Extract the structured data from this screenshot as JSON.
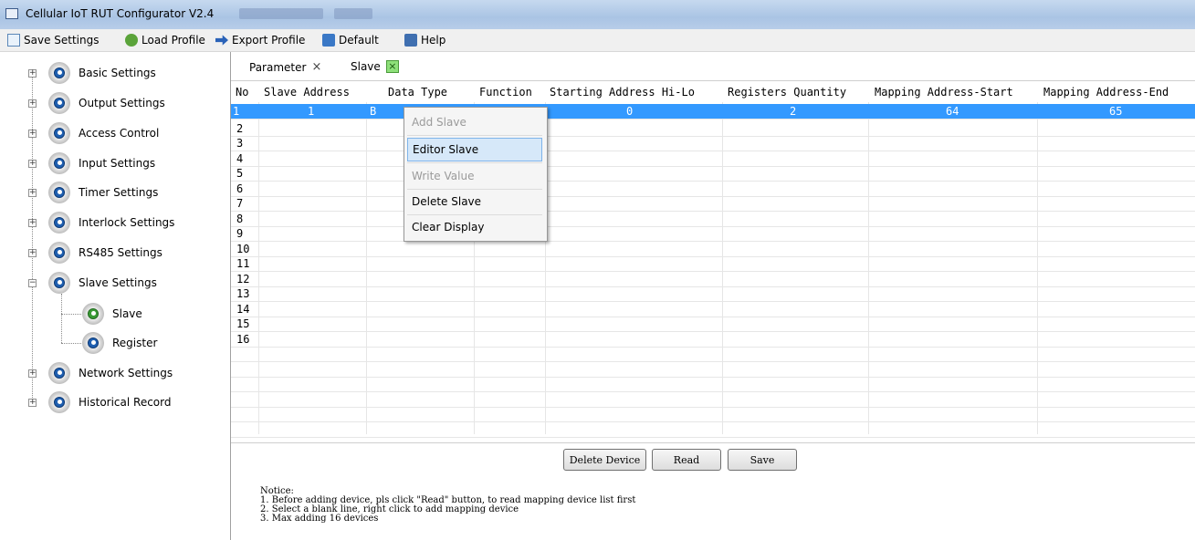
{
  "window": {
    "title": "Cellular IoT RUT Configurator V2.4"
  },
  "toolbar": {
    "save": "Save Settings",
    "load": "Load Profile",
    "export": "Export Profile",
    "default": "Default",
    "help": "Help"
  },
  "sidebar": {
    "items": [
      {
        "label": "Basic Settings"
      },
      {
        "label": "Output Settings"
      },
      {
        "label": "Access Control"
      },
      {
        "label": "Input Settings"
      },
      {
        "label": "Timer Settings"
      },
      {
        "label": "Interlock Settings"
      },
      {
        "label": "RS485 Settings"
      },
      {
        "label": "Slave Settings"
      },
      {
        "label": "Slave"
      },
      {
        "label": "Register"
      },
      {
        "label": "Network Settings"
      },
      {
        "label": "Historical Record"
      }
    ]
  },
  "tabs": [
    {
      "label": "Parameter",
      "close": "×"
    },
    {
      "label": "Slave",
      "close": "×"
    }
  ],
  "table": {
    "headers": [
      "No",
      "Slave Address",
      "Data Type",
      "Function",
      "Starting Address Hi-Lo",
      "Registers Quantity",
      "Mapping Address-Start",
      "Mapping Address-End"
    ],
    "row1": {
      "no": "1",
      "slave_address": "1",
      "data_type": "B",
      "starting_address": "0",
      "registers_quantity": "2",
      "mapping_start": "64",
      "mapping_end": "65"
    },
    "row_numbers": [
      "2",
      "3",
      "4",
      "5",
      "6",
      "7",
      "8",
      "9",
      "10",
      "11",
      "12",
      "13",
      "14",
      "15",
      "16"
    ]
  },
  "context_menu": {
    "add": "Add Slave",
    "editor": "Editor Slave",
    "write": "Write Value",
    "delete": "Delete Slave",
    "clear": "Clear Display"
  },
  "buttons": {
    "delete_device": "Delete Device",
    "read": "Read",
    "save": "Save"
  },
  "notice": {
    "title": "Notice:",
    "line1": "1. Before adding device, pls click \"Read\" button, to read mapping device list first",
    "line2": "2. Select a blank line, right click to add mapping device",
    "line3": "3. Max adding 16 devices"
  },
  "colors": {
    "selection": "#3399ff",
    "titlebar": "#b7cde9",
    "menu_highlight": "#d6e8f9"
  }
}
